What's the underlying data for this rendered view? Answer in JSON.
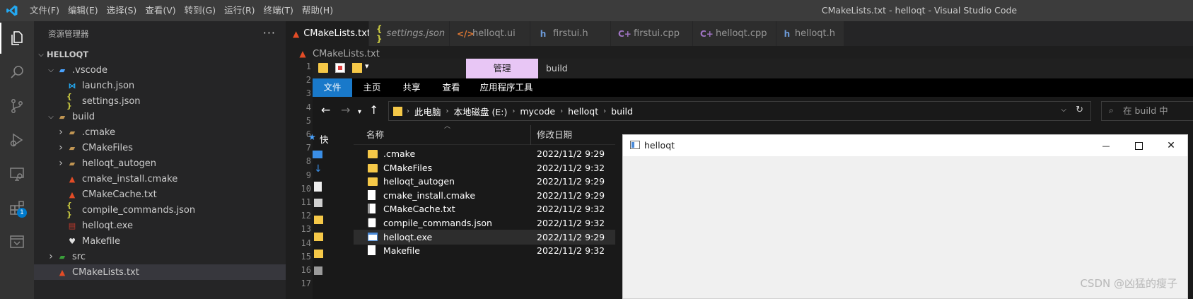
{
  "titlebar": {
    "menu": [
      "文件(F)",
      "编辑(E)",
      "选择(S)",
      "查看(V)",
      "转到(G)",
      "运行(R)",
      "终端(T)",
      "帮助(H)"
    ],
    "window_title": "CMakeLists.txt - helloqt - Visual Studio Code"
  },
  "activitybar": {
    "icons": [
      "explorer-icon",
      "search-icon",
      "source-control-icon",
      "run-debug-icon",
      "remote-explorer-icon",
      "extensions-icon",
      "qt-icon"
    ],
    "extensions_badge": "1"
  },
  "sidebar": {
    "header": "资源管理器",
    "more": "···",
    "root": "HELLOQT",
    "items": [
      {
        "label": ".vscode",
        "icon": "vscode-folder-icon",
        "depth": 1,
        "twisty": "open"
      },
      {
        "label": "launch.json",
        "icon": "vscode-file-icon",
        "depth": 2,
        "twisty": "none"
      },
      {
        "label": "settings.json",
        "icon": "json-icon",
        "depth": 2,
        "twisty": "none"
      },
      {
        "label": "build",
        "icon": "folder-icon",
        "depth": 1,
        "twisty": "open"
      },
      {
        "label": ".cmake",
        "icon": "cmake-folder-icon",
        "depth": 2,
        "twisty": "closed"
      },
      {
        "label": "CMakeFiles",
        "icon": "folder-icon",
        "depth": 2,
        "twisty": "closed"
      },
      {
        "label": "helloqt_autogen",
        "icon": "folder-icon",
        "depth": 2,
        "twisty": "closed"
      },
      {
        "label": "cmake_install.cmake",
        "icon": "cmake-icon",
        "depth": 2,
        "twisty": "none"
      },
      {
        "label": "CMakeCache.txt",
        "icon": "cmake-icon",
        "depth": 2,
        "twisty": "none"
      },
      {
        "label": "compile_commands.json",
        "icon": "json-icon",
        "depth": 2,
        "twisty": "none"
      },
      {
        "label": "helloqt.exe",
        "icon": "exe-icon",
        "depth": 2,
        "twisty": "none"
      },
      {
        "label": "Makefile",
        "icon": "makefile-icon",
        "depth": 2,
        "twisty": "none"
      },
      {
        "label": "src",
        "icon": "src-folder-icon",
        "depth": 1,
        "twisty": "closed"
      },
      {
        "label": "CMakeLists.txt",
        "icon": "cmake-icon",
        "depth": 1,
        "twisty": "none",
        "selected": true
      }
    ]
  },
  "editor": {
    "tabs": [
      {
        "label": "CMakeLists.txt",
        "icon": "cmake-icon",
        "active": true,
        "italic": false
      },
      {
        "label": "settings.json",
        "icon": "json-icon",
        "active": false,
        "italic": true
      },
      {
        "label": "helloqt.ui",
        "icon": "xml-icon",
        "active": false,
        "italic": false
      },
      {
        "label": "firstui.h",
        "icon": "header-icon",
        "active": false,
        "italic": false
      },
      {
        "label": "firstui.cpp",
        "icon": "cpp-icon",
        "active": false,
        "italic": false
      },
      {
        "label": "helloqt.cpp",
        "icon": "cpp-icon",
        "active": false,
        "italic": false
      },
      {
        "label": "helloqt.h",
        "icon": "header-icon",
        "active": false,
        "italic": false
      }
    ],
    "tab_close": "×",
    "breadcrumb": "CMakeLists.txt",
    "line_numbers": [
      "1",
      "2",
      "3",
      "4",
      "5",
      "6",
      "7",
      "8",
      "9",
      "10",
      "11",
      "12",
      "13",
      "14",
      "15",
      "16",
      "17"
    ]
  },
  "file_explorer": {
    "context_tab": "管理",
    "context_title": "build",
    "ribbon_tabs": [
      "文件",
      "主页",
      "共享",
      "查看",
      "应用程序工具"
    ],
    "path": [
      "此电脑",
      "本地磁盘 (E:)",
      "mycode",
      "helloqt",
      "build"
    ],
    "search_placeholder": "在 build 中",
    "columns": {
      "name": "名称",
      "modified": "修改日期"
    },
    "nav_quick_access": "快",
    "files": [
      {
        "name": ".cmake",
        "modified": "2022/11/2 9:29",
        "icon": "folder-icon"
      },
      {
        "name": "CMakeFiles",
        "modified": "2022/11/2 9:32",
        "icon": "folder-icon"
      },
      {
        "name": "helloqt_autogen",
        "modified": "2022/11/2 9:29",
        "icon": "folder-icon"
      },
      {
        "name": "cmake_install.cmake",
        "modified": "2022/11/2 9:29",
        "icon": "file-icon"
      },
      {
        "name": "CMakeCache.txt",
        "modified": "2022/11/2 9:32",
        "icon": "text-file-icon"
      },
      {
        "name": "compile_commands.json",
        "modified": "2022/11/2 9:32",
        "icon": "script-file-icon"
      },
      {
        "name": "helloqt.exe",
        "modified": "2022/11/2 9:29",
        "icon": "exe-window-icon",
        "hover": true
      },
      {
        "name": "Makefile",
        "modified": "2022/11/2 9:32",
        "icon": "file-icon"
      }
    ]
  },
  "qt_window": {
    "title": "helloqt",
    "minimize": "—",
    "close": "✕"
  },
  "watermark": "CSDN @凶猛的瘦子",
  "colors": {
    "accent": "#007acc",
    "ribbon_active": "#1979ca",
    "context_tab": "#e8c6f5",
    "cmake_red": "#e34c26"
  }
}
